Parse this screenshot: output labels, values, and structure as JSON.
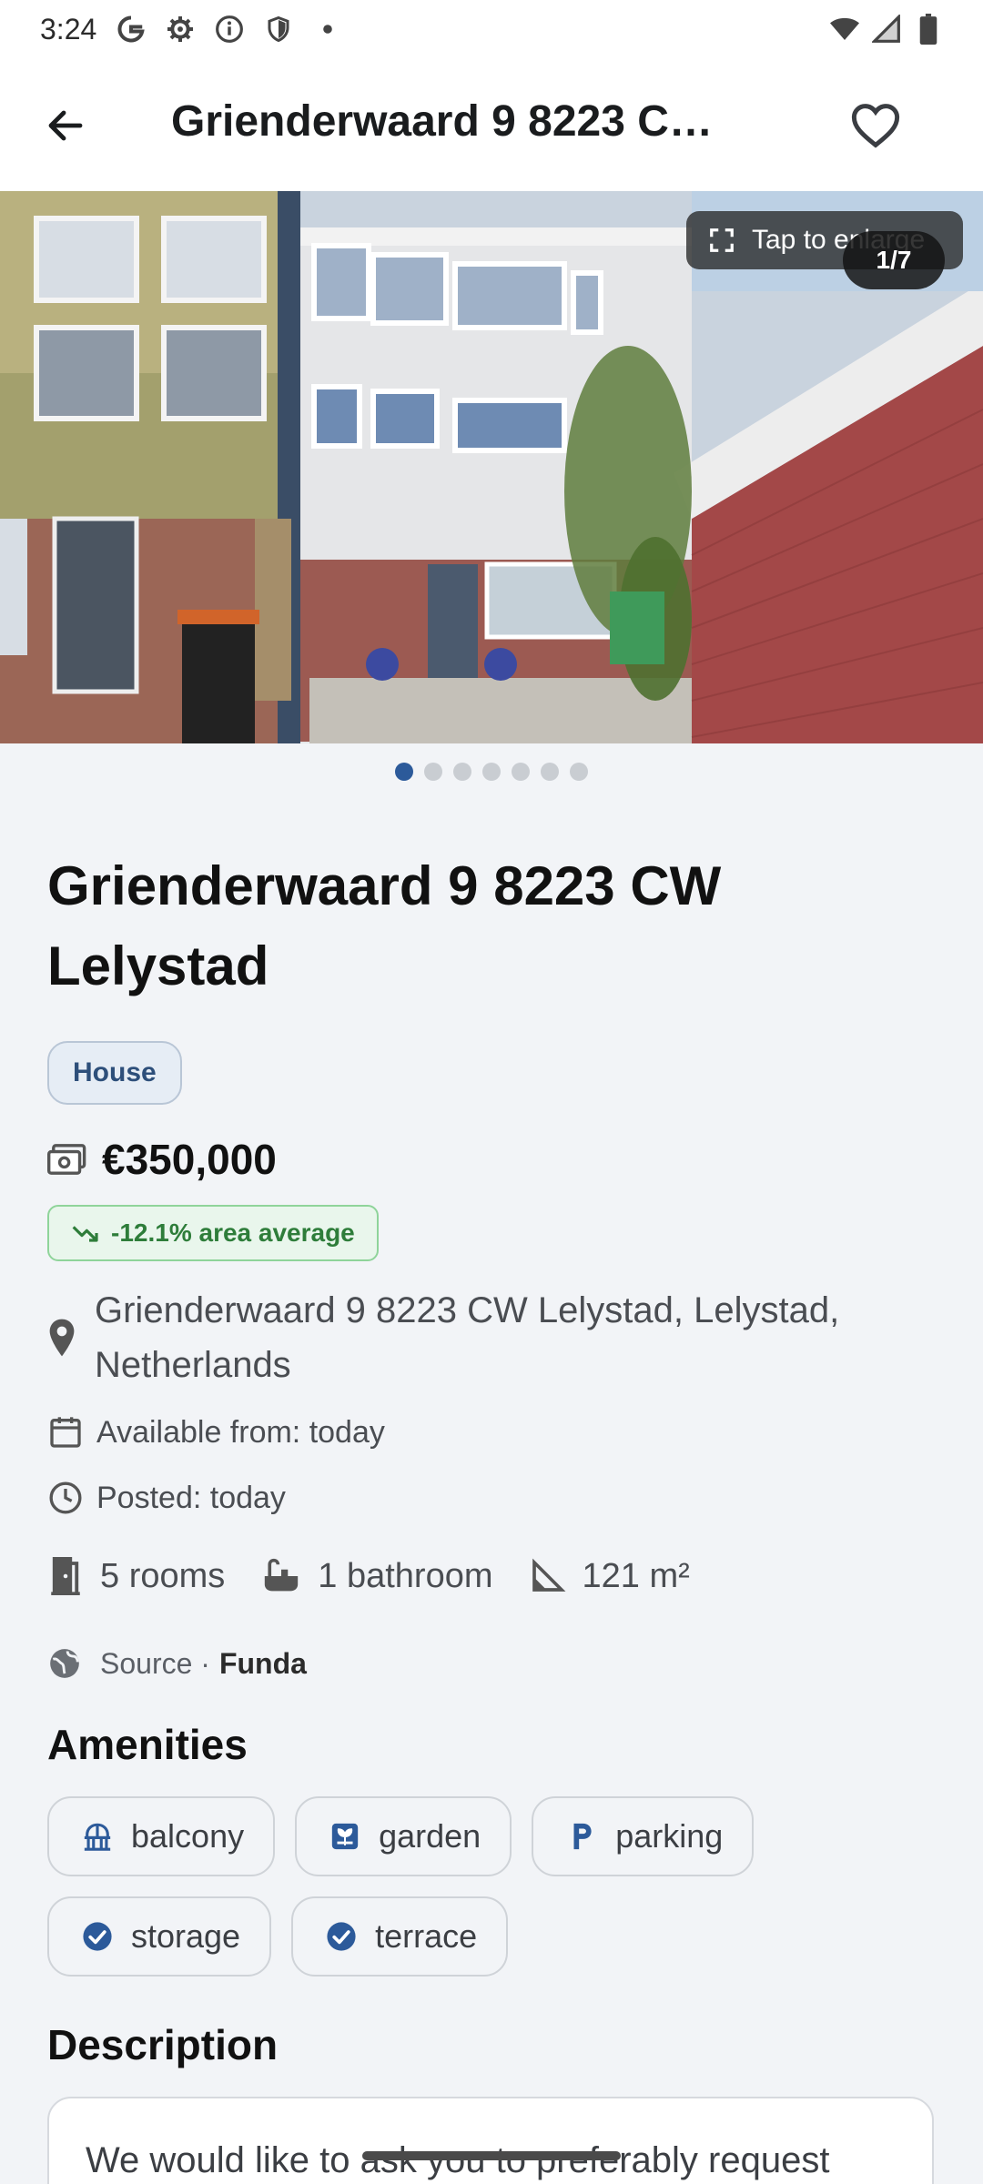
{
  "status_bar": {
    "time": "3:24",
    "icons": [
      "google-icon",
      "settings-icon",
      "info-icon",
      "shield-icon",
      "dot-icon"
    ],
    "right_icons": [
      "wifi-icon",
      "signal-icon",
      "battery-icon"
    ]
  },
  "app_bar": {
    "title": "Grienderwaard 9 8223 C…",
    "back_icon": "arrow-back-icon",
    "favorite_icon": "heart-outline-icon"
  },
  "gallery": {
    "enlarge_label": "Tap to enlarge",
    "counter": "1/7",
    "dot_count": 7,
    "active_dot": 0
  },
  "listing": {
    "title": "Grienderwaard 9 8223 CW Lelystad",
    "type": "House",
    "price": "€350,000",
    "area_average": "-12.1% area average",
    "address": "Grienderwaard 9 8223 CW Lelystad, Lelystad, Netherlands",
    "available": "Available from: today",
    "posted": "Posted: today",
    "rooms": "5 rooms",
    "bathrooms": "1 bathroom",
    "area": "121 m²",
    "source_label": "Source ·",
    "source_name": "Funda"
  },
  "amenities": {
    "title": "Amenities",
    "items": [
      {
        "label": "balcony",
        "icon": "balcony-icon"
      },
      {
        "label": "garden",
        "icon": "garden-icon"
      },
      {
        "label": "parking",
        "icon": "parking-icon"
      },
      {
        "label": "storage",
        "icon": "check-circle-icon"
      },
      {
        "label": "terrace",
        "icon": "check-circle-icon"
      }
    ]
  },
  "description": {
    "title": "Description",
    "text": "We would like to ask you to preferably request"
  },
  "colors": {
    "accent": "#2c5a9a",
    "positive": "#2e7d3a",
    "background": "#f2f4f7"
  }
}
